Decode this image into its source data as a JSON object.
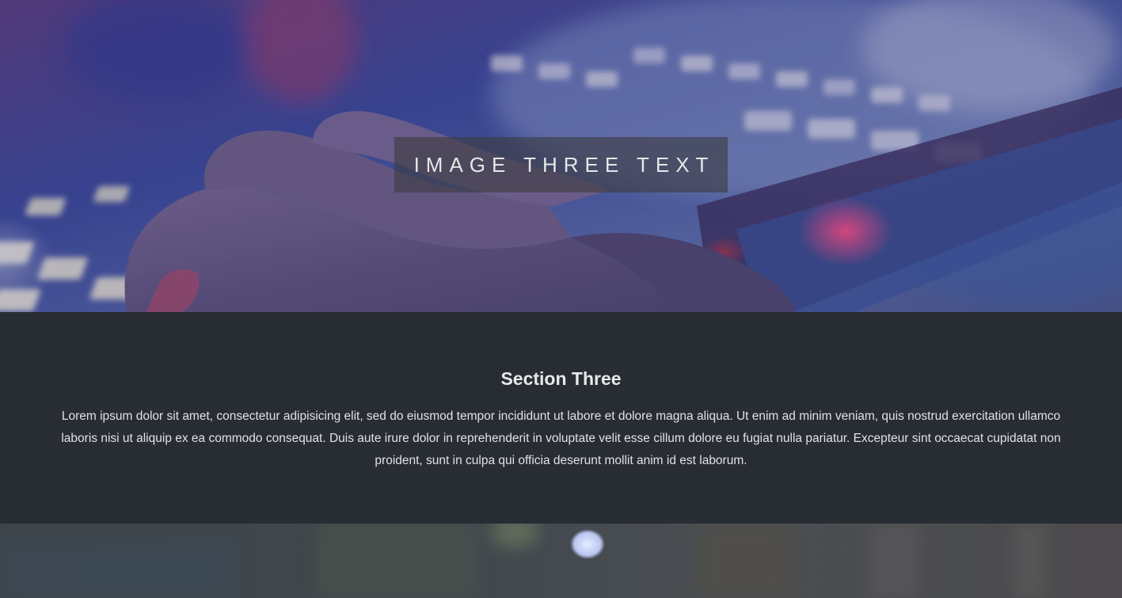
{
  "hero": {
    "caption": "IMAGE THREE TEXT"
  },
  "section": {
    "title": "Section Three",
    "body": "Lorem ipsum dolor sit amet, consectetur adipisicing elit, sed do eiusmod tempor incididunt ut labore et dolore magna aliqua. Ut enim ad minim veniam, quis nostrud exercitation ullamco laboris nisi ut aliquip ex ea commodo consequat. Duis aute irure dolor in reprehenderit in voluptate velit esse cillum dolore eu fugiat nulla pariatur. Excepteur sint occaecat cupidatat non proident, sunt in culpa qui officia deserunt mollit anim id est laborum."
  },
  "colors": {
    "section_background": "#282c33",
    "caption_background": "rgba(60,60,64,0.62)",
    "text": "#e2e2e4"
  }
}
